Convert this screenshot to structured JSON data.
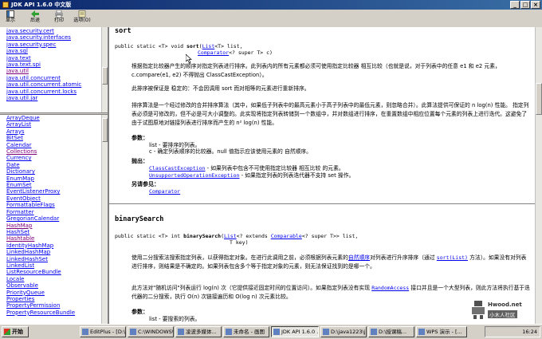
{
  "window": {
    "title": "JDK API 1.6.0 中文版"
  },
  "toolbar": {
    "buttons": [
      "显示",
      "后退",
      "打印",
      "选项(O)"
    ]
  },
  "packages": [
    "java.security.cert",
    "java.security.interfaces",
    "java.security.spec",
    "java.sql",
    "java.text",
    "java.text.spi",
    "java.util",
    "java.util.concurrent",
    "java.util.concurrent.atomic",
    "java.util.concurrent.locks",
    "java.util.jar"
  ],
  "classes": [
    "ArrayDeque",
    "ArrayList",
    "Arrays",
    "BitSet",
    "Calendar",
    "Collections",
    "Currency",
    "Date",
    "Dictionary",
    "EnumMap",
    "EnumSet",
    "EventListenerProxy",
    "EventObject",
    "FormattableFlags",
    "Formatter",
    "GregorianCalendar",
    "HashMap",
    "HashSet",
    "Hashtable",
    "IdentityHashMap",
    "LinkedHashMap",
    "LinkedHashSet",
    "LinkedList",
    "ListResourceBundle",
    "Locale",
    "Observable",
    "PriorityQueue",
    "Properties",
    "PropertyPermission",
    "PropertyResourceBundle"
  ],
  "doc": {
    "sort": {
      "name": "sort",
      "sig1": "public static <T> void ",
      "sig_name": "sort",
      "sig2": "(",
      "sig_list": "List",
      "sig3": "<T> list,",
      "sig_comparator": "Comparator",
      "sig4": "<? super T> c)",
      "p1": "根据指定比较器产生的顺序对指定列表进行排序。此列表内的所有元素都必须可使用指定比较器 相互比较（也就是说，对于列表中的任意 e1 和 e2 元素，c.compare(e1, e2) 不得抛出 ClassCastException）。",
      "p2": "此排序被保证是 稳定的：不会因调用 sort 而对相等的元素进行重新排序。",
      "p3": "排序算法是一个经过修改的合并排序算法（其中，如果低子列表中的最高元素小于高子列表中的最低元素，则忽略合并）。此算法提供可保证的 n log(n) 性能。 指定列表必须是可修改的，但不必是可大小调整的。此实现将指定列表转储到一个数组中，并对数组进行排序，在重置数组中相应位置每个元素的列表上进行迭代。这避免了由于试图原地对链接列表进行排序而产生的 n² log(n) 性能。",
      "params_label": "参数：",
      "param1": "list - 要排序的列表。",
      "param2": "c - 确定列表顺序的比较器。null 值指示应该使用元素的 自然顺序。",
      "throws_label": "抛出：",
      "throw1_link": "ClassCastException",
      "throw1_text": " - 如果列表中包含不可使用指定比较器 相互比较 的元素。",
      "throw2_link": "UnsupportedOperationException",
      "throw2_text": " - 如果指定列表的列表迭代器不支持 set 操作。",
      "see_label": "另请参见：",
      "see1": "Comparator"
    },
    "binarySearch": {
      "name": "binarySearch",
      "sig1": "public static <T> int ",
      "sig_name": "binarySearch",
      "sig2": "(",
      "sig_list": "List",
      "sig3": "<? extends ",
      "sig_comparable": "Comparable",
      "sig4": "<? super T>> list,",
      "sig5": "T key)",
      "p1a": "使用二分搜索法搜索指定列表，以获得指定对象。在进行此调用之前，必须根据列表元素的",
      "p1_link1": "自然顺序",
      "p1b": "对列表进行升序排序（通过 ",
      "p1_link2": "sort(List)",
      "p1c": " 方法）。如果没有对列表进行排序，则结果是不确定的。如果列表包含多个等于指定对象的元素，则无法保证找到的是哪一个。",
      "p2a": "此方法对\"随机访问\"列表运行 log(n) 次（它提供接近固定时间的位置访问）。如果指定列表没有实现 ",
      "p2_link": "RandomAccess",
      "p2b": " 接口并且是一个大型列表，则此方法将执行基于迭代器的二分搜索，执行 O(n) 次链接遍历和 O(log n) 次元素比较。",
      "params_label": "参数：",
      "param1": "list - 要搜索的列表。"
    }
  },
  "taskbar": {
    "start": "开始",
    "tasks": [
      "EditPlus - [D:\\j...",
      "C:\\WINDOWS\\...",
      "凌波多媒体...",
      "未命名 - 画图",
      "JDK API 1.6.0 ...",
      "D:\\java1223\\jl...",
      "D:\\授课稿...",
      "WPS 演示 - [..."
    ],
    "clock": "16:24"
  },
  "watermark": {
    "text": "小木人社区",
    "brand": "Hwood.net"
  },
  "colors": {
    "link": "#0000ee",
    "visited": "#800080",
    "title_bar": "#0a246a"
  }
}
